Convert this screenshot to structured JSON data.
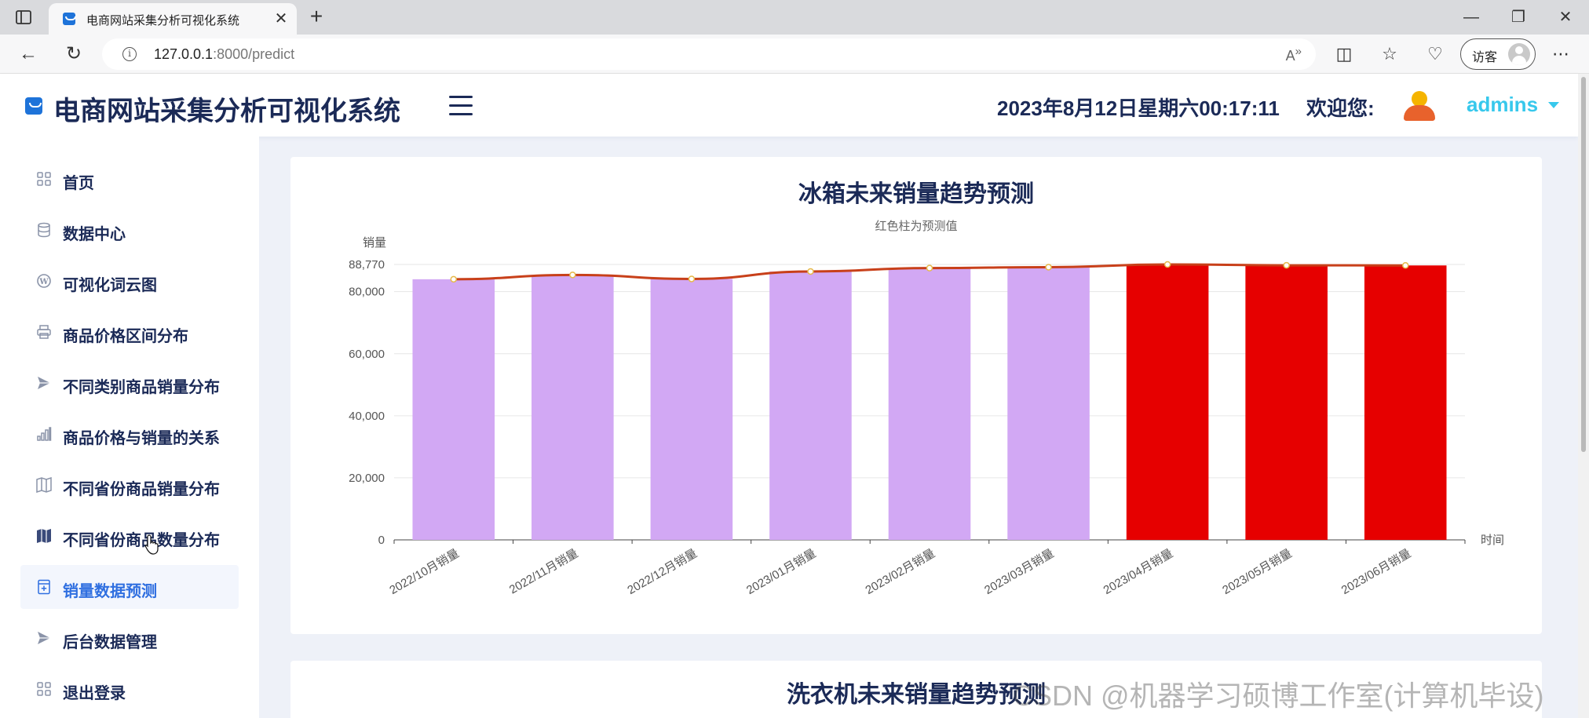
{
  "browser": {
    "tab_title": "电商网站采集分析可视化系统",
    "url_host": "127.0.0.1",
    "url_rest": ":8000/predict",
    "guest_label": "访客"
  },
  "header": {
    "brand_title": "电商网站采集分析可视化系统",
    "datetime": "2023年8月12日星期六00:17:11",
    "welcome": "欢迎您:",
    "username": "admins"
  },
  "sidebar": {
    "items": [
      {
        "label": "首页",
        "icon": "grid-icon"
      },
      {
        "label": "数据中心",
        "icon": "database-icon"
      },
      {
        "label": "可视化词云图",
        "icon": "wordpress-icon"
      },
      {
        "label": "商品价格区间分布",
        "icon": "printer-icon"
      },
      {
        "label": "不同类别商品销量分布",
        "icon": "send-icon"
      },
      {
        "label": "商品价格与销量的关系",
        "icon": "bar-chart-icon"
      },
      {
        "label": "不同省份商品销量分布",
        "icon": "map-icon"
      },
      {
        "label": "不同省份商品数量分布",
        "icon": "map-filled-icon"
      },
      {
        "label": "销量数据预测",
        "icon": "calculator-icon"
      },
      {
        "label": "后台数据管理",
        "icon": "send-icon"
      },
      {
        "label": "退出登录",
        "icon": "grid-icon"
      }
    ],
    "active_index": 8
  },
  "chart_data": [
    {
      "type": "bar",
      "title": "冰箱未来销量趋势预测",
      "subtitle": "红色柱为预测值",
      "ylabel": "销量",
      "xlabel": "时间",
      "categories": [
        "2022/10月销量",
        "2022/11月销量",
        "2022/12月销量",
        "2023/01月销量",
        "2023/02月销量",
        "2023/03月销量",
        "2023/04月销量",
        "2023/05月销量",
        "2023/06月销量"
      ],
      "values": [
        84000,
        85400,
        84100,
        86500,
        87600,
        87900,
        88770,
        88500,
        88450
      ],
      "predicted": [
        false,
        false,
        false,
        false,
        false,
        false,
        true,
        true,
        true
      ],
      "yticks": [
        "0",
        "20,000",
        "40,000",
        "60,000",
        "80,000",
        "88,770"
      ],
      "ylim": [
        0,
        88770
      ],
      "colors": {
        "actual": "#d2a8f4",
        "predicted": "#e60000",
        "line": "#c8401a",
        "marker": "#e6b94a"
      },
      "grid": true,
      "line_overlay": true
    },
    {
      "type": "bar",
      "title": "洗衣机未来销量趋势预测"
    }
  ],
  "watermark": "CSDN @机器学习硕博工作室(计算机毕设)"
}
